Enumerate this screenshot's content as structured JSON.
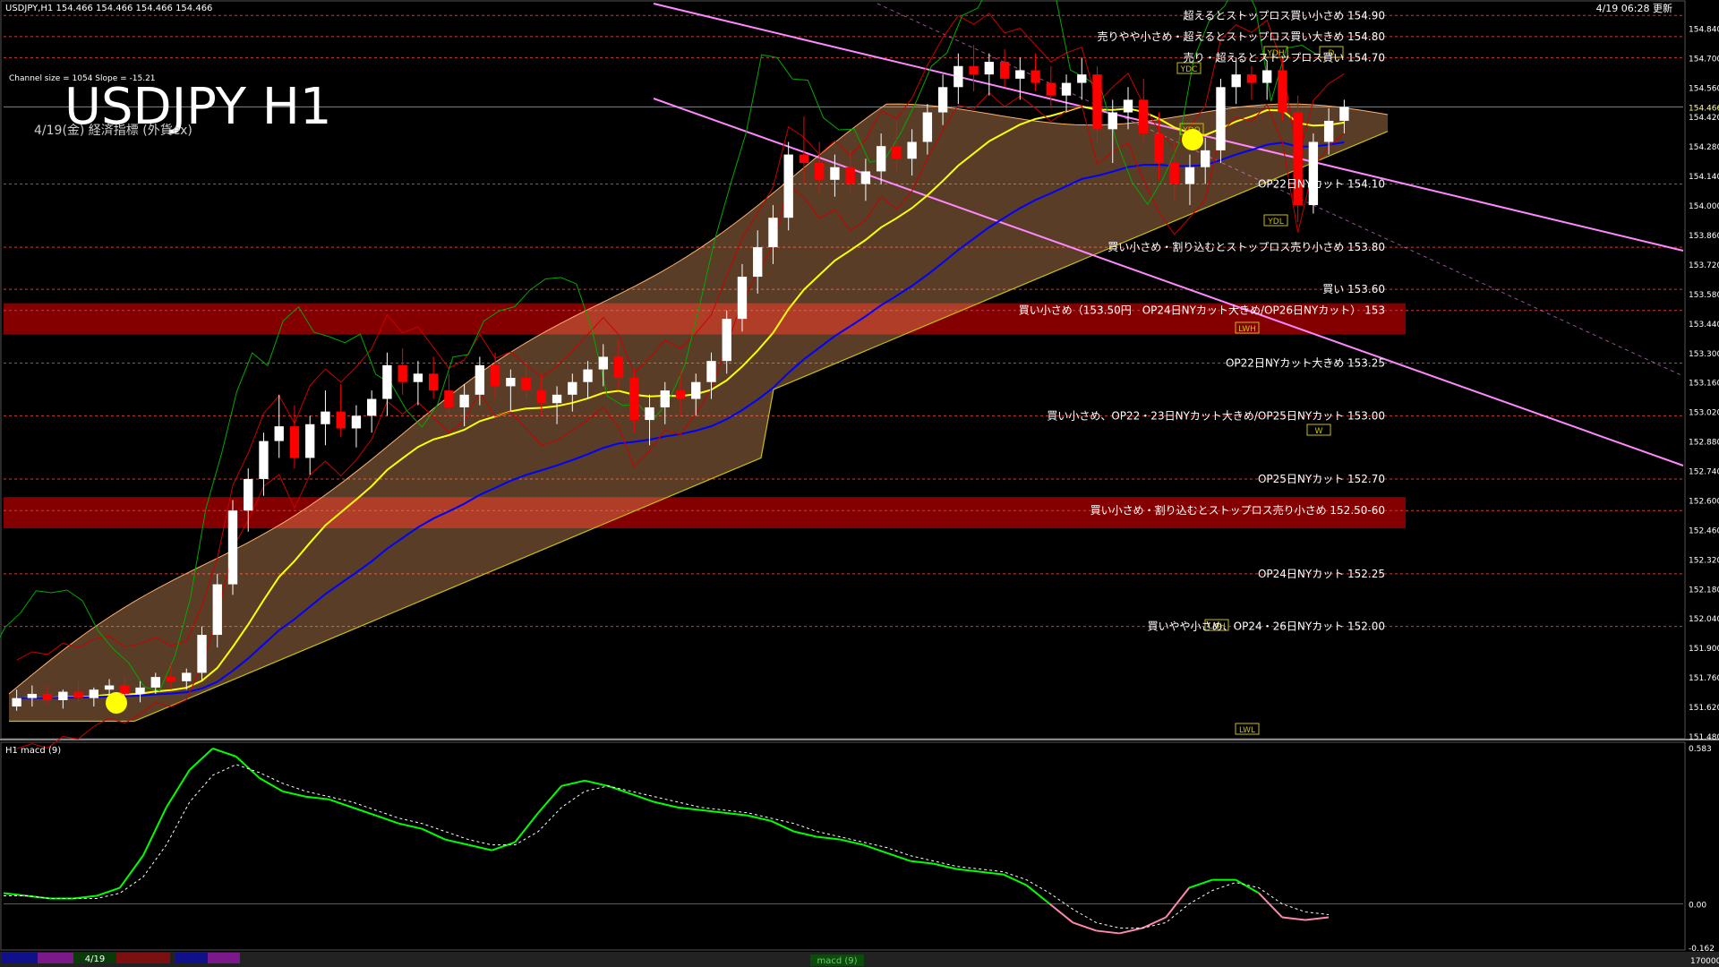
{
  "header": {
    "symbol_info": "USDJPY,H1  154.466 154.466 154.466 154.466",
    "timestamp": "4/19 06:28 更新",
    "channel_info": "Channel size = 1054 Slope = -15.21",
    "big_title": "USDJPY H1",
    "subtitle": "4/19(金) 経済指標 (外貨ex)"
  },
  "colors": {
    "background": "#000000",
    "resistance_line": "#c04040",
    "support_band": "#8b0000",
    "channel": "#ff88ff",
    "ema_fast": "#ffff00",
    "ema_slow": "#0000ff",
    "macd_main": "#00ff00",
    "macd_negative": "#ff88aa",
    "cloud_bull": "#ffb070",
    "cloud_bear": "#1030a0",
    "bull_candle": "#ffffff",
    "bear_candle": "#ff0000"
  },
  "chart_data": [
    {
      "type": "candlestick",
      "symbol": "USDJPY",
      "timeframe": "H1",
      "ylim": [
        151.48,
        154.88
      ],
      "price_axis_ticks": [
        "154.840",
        "154.700",
        "154.560",
        "154.420",
        "154.280",
        "154.140",
        "154.000",
        "153.860",
        "153.720",
        "153.580",
        "153.440",
        "153.300",
        "153.160",
        "153.020",
        "152.880",
        "152.740",
        "152.600",
        "152.460",
        "152.320",
        "152.180",
        "152.040",
        "151.900",
        "151.760",
        "151.620",
        "151.480"
      ],
      "current_price_label": "154.466",
      "ohlc": [
        [
          151.62,
          151.7,
          151.6,
          151.66
        ],
        [
          151.66,
          151.72,
          151.62,
          151.68
        ],
        [
          151.68,
          151.72,
          151.63,
          151.65
        ],
        [
          151.65,
          151.7,
          151.61,
          151.69
        ],
        [
          151.69,
          151.74,
          151.64,
          151.66
        ],
        [
          151.66,
          151.71,
          151.62,
          151.7
        ],
        [
          151.7,
          151.75,
          151.66,
          151.72
        ],
        [
          151.72,
          151.76,
          151.66,
          151.68
        ],
        [
          151.68,
          151.74,
          151.64,
          151.71
        ],
        [
          151.71,
          151.78,
          151.68,
          151.76
        ],
        [
          151.76,
          151.82,
          151.7,
          151.74
        ],
        [
          151.74,
          151.8,
          151.7,
          151.78
        ],
        [
          151.78,
          152.0,
          151.74,
          151.96
        ],
        [
          151.96,
          152.25,
          151.9,
          152.2
        ],
        [
          152.2,
          152.6,
          152.15,
          152.55
        ],
        [
          152.55,
          152.75,
          152.45,
          152.7
        ],
        [
          152.7,
          152.92,
          152.62,
          152.88
        ],
        [
          152.88,
          153.1,
          152.8,
          152.95
        ],
        [
          152.95,
          153.05,
          152.75,
          152.8
        ],
        [
          152.8,
          153.0,
          152.72,
          152.96
        ],
        [
          152.96,
          153.12,
          152.86,
          153.02
        ],
        [
          153.02,
          153.15,
          152.9,
          152.94
        ],
        [
          152.94,
          153.05,
          152.85,
          153.0
        ],
        [
          153.0,
          153.12,
          152.92,
          153.08
        ],
        [
          153.08,
          153.3,
          153.0,
          153.24
        ],
        [
          153.24,
          153.32,
          153.1,
          153.16
        ],
        [
          153.16,
          153.26,
          153.05,
          153.2
        ],
        [
          153.2,
          153.28,
          153.08,
          153.12
        ],
        [
          153.12,
          153.2,
          153.0,
          153.04
        ],
        [
          153.04,
          153.15,
          152.95,
          153.1
        ],
        [
          153.1,
          153.28,
          153.05,
          153.24
        ],
        [
          153.24,
          153.3,
          153.08,
          153.14
        ],
        [
          153.14,
          153.22,
          153.02,
          153.18
        ],
        [
          153.18,
          153.26,
          153.08,
          153.12
        ],
        [
          153.12,
          153.2,
          153.0,
          153.06
        ],
        [
          153.06,
          153.14,
          152.96,
          153.1
        ],
        [
          153.1,
          153.2,
          153.02,
          153.16
        ],
        [
          153.16,
          153.26,
          153.08,
          153.22
        ],
        [
          153.22,
          153.34,
          153.14,
          153.28
        ],
        [
          153.28,
          153.36,
          153.12,
          153.18
        ],
        [
          153.18,
          153.22,
          152.92,
          152.98
        ],
        [
          152.98,
          153.1,
          152.86,
          153.04
        ],
        [
          153.04,
          153.16,
          152.96,
          153.12
        ],
        [
          153.12,
          153.22,
          153.0,
          153.08
        ],
        [
          153.08,
          153.2,
          153.0,
          153.16
        ],
        [
          153.16,
          153.3,
          153.08,
          153.26
        ],
        [
          153.26,
          153.5,
          153.2,
          153.46
        ],
        [
          153.46,
          153.72,
          153.4,
          153.66
        ],
        [
          153.66,
          153.88,
          153.58,
          153.8
        ],
        [
          153.8,
          154.0,
          153.72,
          153.94
        ],
        [
          153.94,
          154.3,
          153.88,
          154.24
        ],
        [
          154.24,
          154.42,
          154.1,
          154.2
        ],
        [
          154.2,
          154.3,
          154.06,
          154.12
        ],
        [
          154.12,
          154.24,
          154.04,
          154.18
        ],
        [
          154.18,
          154.26,
          154.06,
          154.1
        ],
        [
          154.1,
          154.22,
          154.02,
          154.16
        ],
        [
          154.16,
          154.34,
          154.1,
          154.28
        ],
        [
          154.28,
          154.4,
          154.16,
          154.22
        ],
        [
          154.22,
          154.36,
          154.14,
          154.3
        ],
        [
          154.3,
          154.48,
          154.24,
          154.44
        ],
        [
          154.44,
          154.62,
          154.38,
          154.56
        ],
        [
          154.56,
          154.72,
          154.48,
          154.66
        ],
        [
          154.66,
          154.76,
          154.54,
          154.62
        ],
        [
          154.62,
          154.72,
          154.52,
          154.68
        ],
        [
          154.68,
          154.74,
          154.56,
          154.6
        ],
        [
          154.6,
          154.7,
          154.5,
          154.64
        ],
        [
          154.64,
          154.72,
          154.54,
          154.58
        ],
        [
          154.58,
          154.66,
          154.46,
          154.52
        ],
        [
          154.52,
          154.62,
          154.44,
          154.58
        ],
        [
          154.58,
          154.7,
          154.5,
          154.62
        ],
        [
          154.62,
          154.66,
          154.3,
          154.36
        ],
        [
          154.36,
          154.5,
          154.2,
          154.44
        ],
        [
          154.44,
          154.56,
          154.36,
          154.5
        ],
        [
          154.5,
          154.6,
          154.3,
          154.34
        ],
        [
          154.34,
          154.44,
          154.12,
          154.2
        ],
        [
          154.2,
          154.3,
          154.02,
          154.1
        ],
        [
          154.1,
          154.24,
          154.0,
          154.18
        ],
        [
          154.18,
          154.32,
          154.1,
          154.26
        ],
        [
          154.26,
          154.6,
          154.2,
          154.56
        ],
        [
          154.56,
          154.7,
          154.48,
          154.62
        ],
        [
          154.62,
          154.66,
          154.5,
          154.58
        ],
        [
          154.58,
          154.68,
          154.5,
          154.64
        ],
        [
          154.64,
          154.7,
          154.4,
          154.44
        ],
        [
          154.44,
          154.52,
          153.92,
          154.0
        ],
        [
          154.0,
          154.34,
          153.96,
          154.3
        ],
        [
          154.3,
          154.46,
          154.24,
          154.4
        ],
        [
          154.4,
          154.5,
          154.34,
          154.466
        ]
      ]
    },
    {
      "type": "line",
      "title": "H1 macd (9)",
      "ylim": [
        -0.162,
        0.583
      ],
      "axis_ticks": [
        "0.583",
        "0.00",
        "-0.162"
      ],
      "series": [
        {
          "values": [
            0.04,
            0.03,
            0.02,
            0.02,
            0.03,
            0.06,
            0.18,
            0.36,
            0.5,
            0.58,
            0.55,
            0.47,
            0.42,
            0.4,
            0.39,
            0.36,
            0.33,
            0.3,
            0.28,
            0.24,
            0.22,
            0.2,
            0.23,
            0.34,
            0.44,
            0.46,
            0.44,
            0.41,
            0.38,
            0.36,
            0.35,
            0.34,
            0.33,
            0.31,
            0.27,
            0.25,
            0.24,
            0.22,
            0.19,
            0.16,
            0.15,
            0.13,
            0.12,
            0.11,
            0.07,
            0.0,
            -0.07,
            -0.1,
            -0.11,
            -0.09,
            -0.05,
            0.06,
            0.09,
            0.09,
            0.04,
            -0.05,
            -0.06,
            -0.05
          ]
        },
        {
          "values": [
            0.03,
            0.03,
            0.02,
            0.02,
            0.02,
            0.04,
            0.1,
            0.22,
            0.38,
            0.48,
            0.52,
            0.49,
            0.45,
            0.42,
            0.4,
            0.38,
            0.35,
            0.32,
            0.3,
            0.27,
            0.24,
            0.22,
            0.22,
            0.27,
            0.36,
            0.42,
            0.44,
            0.42,
            0.4,
            0.38,
            0.36,
            0.35,
            0.34,
            0.32,
            0.3,
            0.27,
            0.25,
            0.23,
            0.21,
            0.18,
            0.16,
            0.14,
            0.13,
            0.12,
            0.09,
            0.04,
            -0.02,
            -0.07,
            -0.09,
            -0.09,
            -0.07,
            0.0,
            0.05,
            0.08,
            0.06,
            0.0,
            -0.03,
            -0.04
          ]
        }
      ]
    }
  ],
  "level_labels": [
    {
      "text": "超えるとストップロス買い小さめ 154.90",
      "price": 154.9
    },
    {
      "text": "売りやや小さめ・超えるとストップロス買い大きめ 154.80",
      "price": 154.8
    },
    {
      "text": "売り・超えるとストップロス買い 154.70",
      "price": 154.7
    },
    {
      "text": "OP22日NYカット 154.10",
      "price": 154.1
    },
    {
      "text": "買い小さめ・割り込むとストップロス売り小さめ 153.80",
      "price": 153.8
    },
    {
      "text": "買い 153.60",
      "price": 153.6
    },
    {
      "text": "買い小さめ（153.50円　OP24日NYカット大きめ/OP26日NYカット） 153",
      "price": 153.5
    },
    {
      "text": "OP22日NYカット大きめ 153.25",
      "price": 153.25
    },
    {
      "text": "買い小さめ、OP22・23日NYカット大きめ/OP25日NYカット 153.00",
      "price": 153.0
    },
    {
      "text": "OP25日NYカット 152.70",
      "price": 152.7
    },
    {
      "text": "買い小さめ・割り込むとストップロス売り小さめ 152.50-60",
      "price": 152.55
    },
    {
      "text": "OP24日NYカット 152.25",
      "price": 152.25
    },
    {
      "text": "買いやや小さめ、OP24・26日NYカット 152.00",
      "price": 152.0
    }
  ],
  "marker_labels": {
    "ydc": "YDC",
    "ydo": "YDO",
    "ydh": "YDH",
    "ydl": "YDL",
    "lwh": "LWH",
    "lwl": "LWL",
    "lmh": "LMH",
    "d": "D",
    "w": "W"
  },
  "footer": {
    "date_label": "4/19",
    "indicator_tab": "macd (9)",
    "right_value": "170000"
  }
}
